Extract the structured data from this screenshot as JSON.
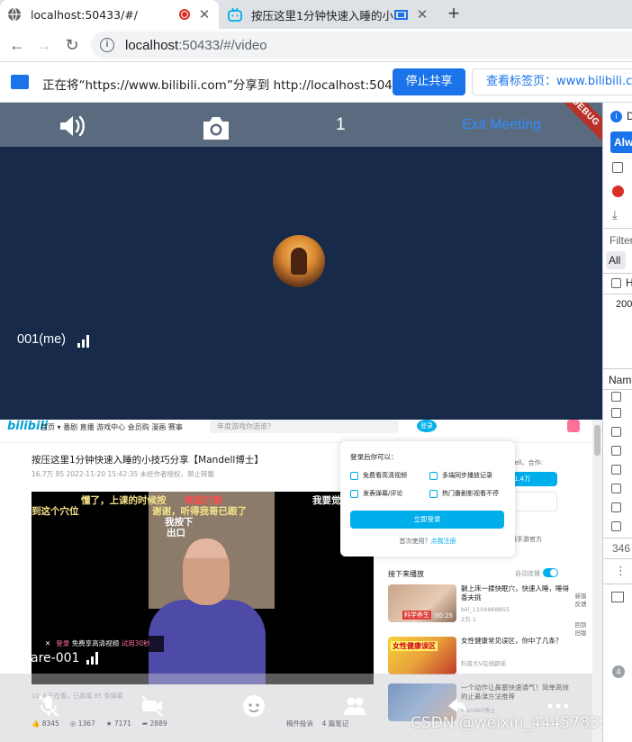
{
  "tabs": [
    {
      "title": "localhost:50433/#/",
      "active": true,
      "recording": true
    },
    {
      "title": "按压这里1分钟快速入睡的小",
      "active": false,
      "casting": true
    }
  ],
  "omnibox": {
    "host": "localhost",
    "port_path": ":50433/#/video"
  },
  "sharebar": {
    "message": "正在将“https://www.bilibili.com”分享到 http://localhost:50433",
    "stop_label": "停止共享",
    "view_label": "查看标签页：www.bilibili.com"
  },
  "meeting": {
    "participant_count": "1",
    "exit_label": "Exit Meeting",
    "debug_ribbon": "DEBUG",
    "main_tile_name": "001(me)",
    "secondary_tile_name": "are-001"
  },
  "bilibili": {
    "logo": "bilibili",
    "nav": "首页 ▾ 番剧 直播 游戏中心 会员购 漫画 赛事",
    "search_placeholder": "年度游戏你选谁?",
    "login_avatar": "登录",
    "video_title": "按压这里1分钟快速入睡的小技巧分享【Mandell博士】",
    "video_meta": "16.7万   85   2022-11-20 15:42:35   未经作者授权，禁止转载",
    "captions": {
      "c1": "懂了，上课的时候按",
      "c2": "美国刀哥",
      "c3": "我要觉",
      "c4": "到这个穴位",
      "c5": "谢谢，听得我哥已跟了",
      "c6": "我按下",
      "c7": "出口"
    },
    "player_tip": {
      "close": "✕",
      "login": "登录",
      "text": "免费享高清视频",
      "trial": "试用30秒"
    },
    "login_popup": {
      "heading": "登录后你可以：",
      "items": [
        "免费看高清视频",
        "多端同步播放记录",
        "发表弹幕/评论",
        "热门番剧影视看不停"
      ],
      "button": "立即登录",
      "footer_prefix": "首次使用？",
      "footer_link": "点我注册"
    },
    "up": {
      "info": "dell、合作:",
      "follow": "1.4万",
      "sub": "播手游官方"
    },
    "recommend": {
      "heading": "接下来播放",
      "autoplay": "自动连播",
      "items": [
        {
          "title": "躺上床一揉快眠穴，快速入睡，睡得香夫挑",
          "author": "bili_1104968855",
          "stats": "2万   1",
          "duration": "00:25",
          "thumb_text": "科学养生"
        },
        {
          "title": "女性健康常见误区，你中了几条？",
          "author": "科普大V在线辟谣",
          "stats": "",
          "duration": "",
          "thumb_text": "女性健康误区"
        },
        {
          "title": "一个动作让鼻塞快速通气！简单高效的止鼻涕方法推荐",
          "author": "Mandell博士",
          "stats": "",
          "duration": "",
          "thumb_text": ""
        }
      ],
      "side_buttons": [
        "新版反馈",
        "回到旧版"
      ]
    },
    "stats_line": "10 人正在看，已装填 85 条弹幕",
    "actions": {
      "like": "8345",
      "coin": "1367",
      "fav": "7171",
      "share": "2889",
      "report": "稿件投诉",
      "notes": "4 篇笔记"
    }
  },
  "watermark": "CSDN @weixin_44457832",
  "devtools": {
    "lines": [
      "D",
      "Alw",
      "Filter",
      "All",
      "H",
      "200",
      "Name",
      "346"
    ]
  },
  "colors": {
    "meet_bar": "#5b6b7f",
    "meet_video": "#172a4a",
    "exit_link": "#2f8cff",
    "chrome_blue": "#1a73e8",
    "bili_blue": "#00aeec"
  }
}
